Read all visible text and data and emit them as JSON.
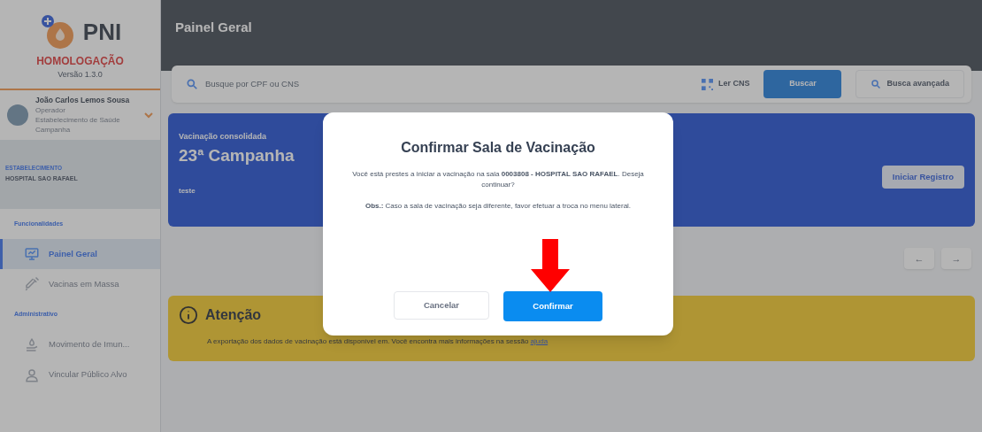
{
  "sidebar": {
    "logo_text": "PNI",
    "environment": "HOMOLOGAÇÃO",
    "version": "Versão 1.3.0",
    "user": {
      "name": "João Carlos Lemos Sousa",
      "role": "Operador",
      "unit": "Estabelecimento de Saúde Campanha"
    },
    "establishment": {
      "label": "ESTABELECIMENTO",
      "name": "HOSPITAL SAO RAFAEL"
    },
    "sections": [
      {
        "title": "Funcionalidades",
        "items": [
          {
            "label": "Painel Geral",
            "selected": true
          },
          {
            "label": "Vacinas em Massa",
            "selected": false
          }
        ]
      },
      {
        "title": "Administrativo",
        "items": [
          {
            "label": "Movimento de Imun...",
            "selected": false
          },
          {
            "label": "Vincular Público Alvo",
            "selected": false
          }
        ]
      }
    ]
  },
  "header": {
    "title": "Painel Geral"
  },
  "search": {
    "placeholder": "Busque por CPF ou CNS",
    "read_button": "Ler CNS",
    "search_button": "Buscar",
    "advanced_button": "Busca avançada"
  },
  "campaign": {
    "label": "Vacinação consolidada",
    "title": "23ª Campanha",
    "note": "teste",
    "button": "Iniciar Registro"
  },
  "pager": [
    "←",
    "→"
  ],
  "attention": {
    "title": "Atenção",
    "text_before": "A exportação dos dados de vacinação está disponível em",
    "text_after": ". Você encontra mais informações na sessão",
    "link": "ajuda"
  },
  "modal": {
    "title": "Confirmar Sala de Vacinação",
    "message": "Você está prestes a iniciar a vacinação na sala **0003808 - HOSPITAL SAO RAFAEL**. Deseja continuar?",
    "note": "**Obs.:** Caso a sala de vacinação seja diferente, favor efetuar a troca no menu lateral.",
    "cancel": "Cancelar",
    "confirm": "Confirmar"
  }
}
